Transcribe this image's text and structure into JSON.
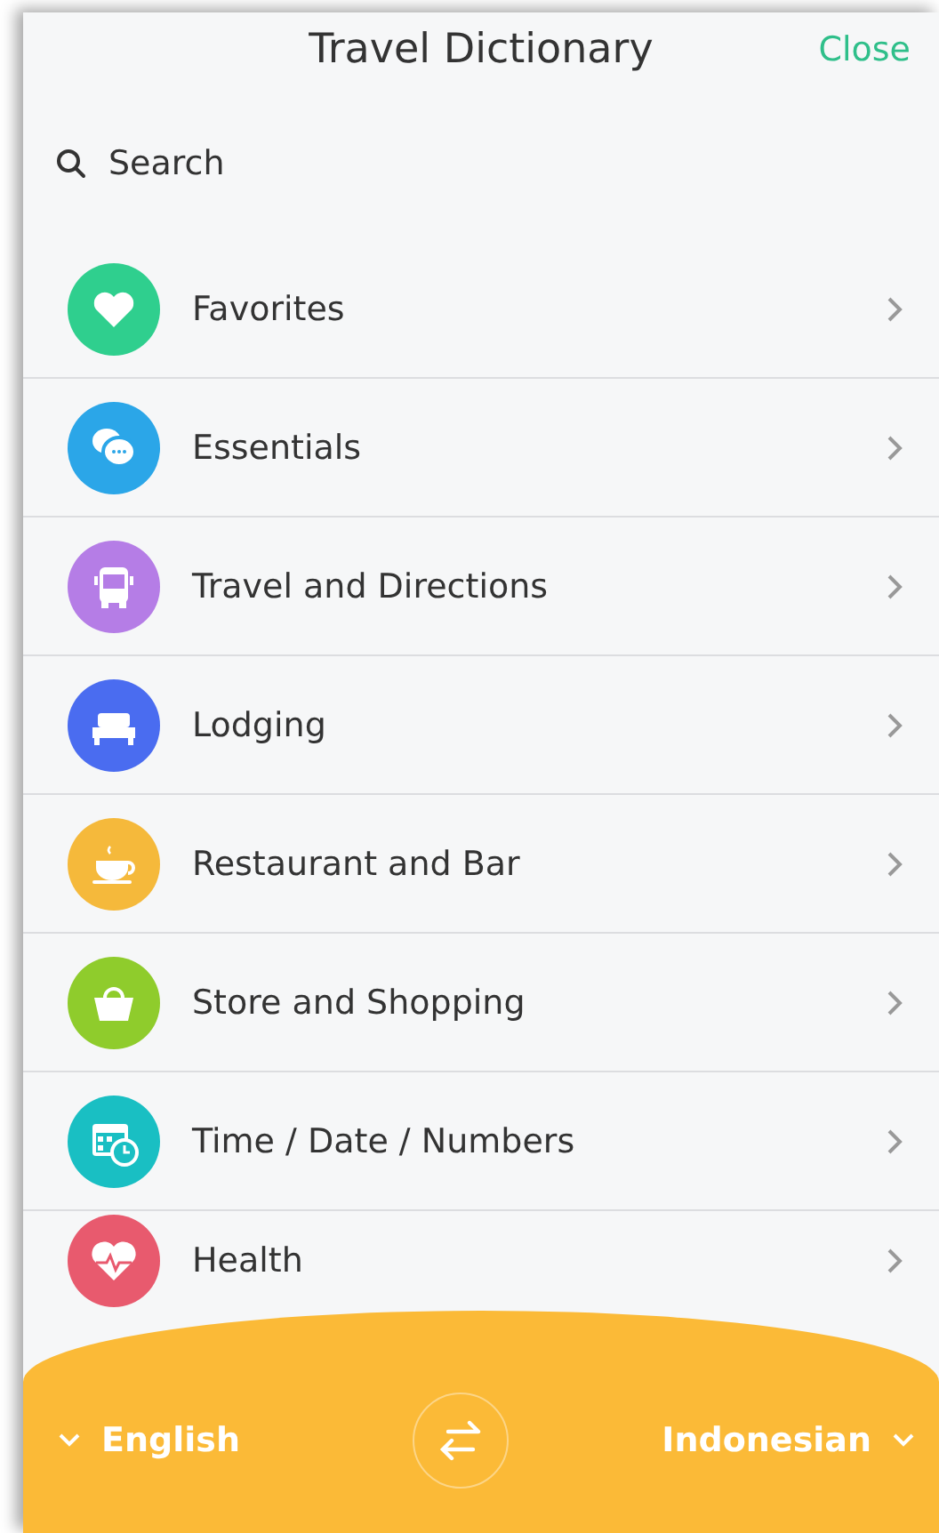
{
  "header": {
    "title": "Travel Dictionary",
    "close": "Close"
  },
  "search": {
    "placeholder": "Search"
  },
  "categories": [
    {
      "label": "Favorites",
      "color": "#2fcf8e"
    },
    {
      "label": "Essentials",
      "color": "#2ba6e8"
    },
    {
      "label": "Travel and Directions",
      "color": "#b57de6"
    },
    {
      "label": "Lodging",
      "color": "#4a6cf0"
    },
    {
      "label": "Restaurant and Bar",
      "color": "#f5b93b"
    },
    {
      "label": "Store and Shopping",
      "color": "#8fcc2c"
    },
    {
      "label": "Time / Date / Numbers",
      "color": "#19bfc3"
    },
    {
      "label": "Health",
      "color": "#e85a6e"
    }
  ],
  "languages": {
    "from": "English",
    "to": "Indonesian"
  }
}
